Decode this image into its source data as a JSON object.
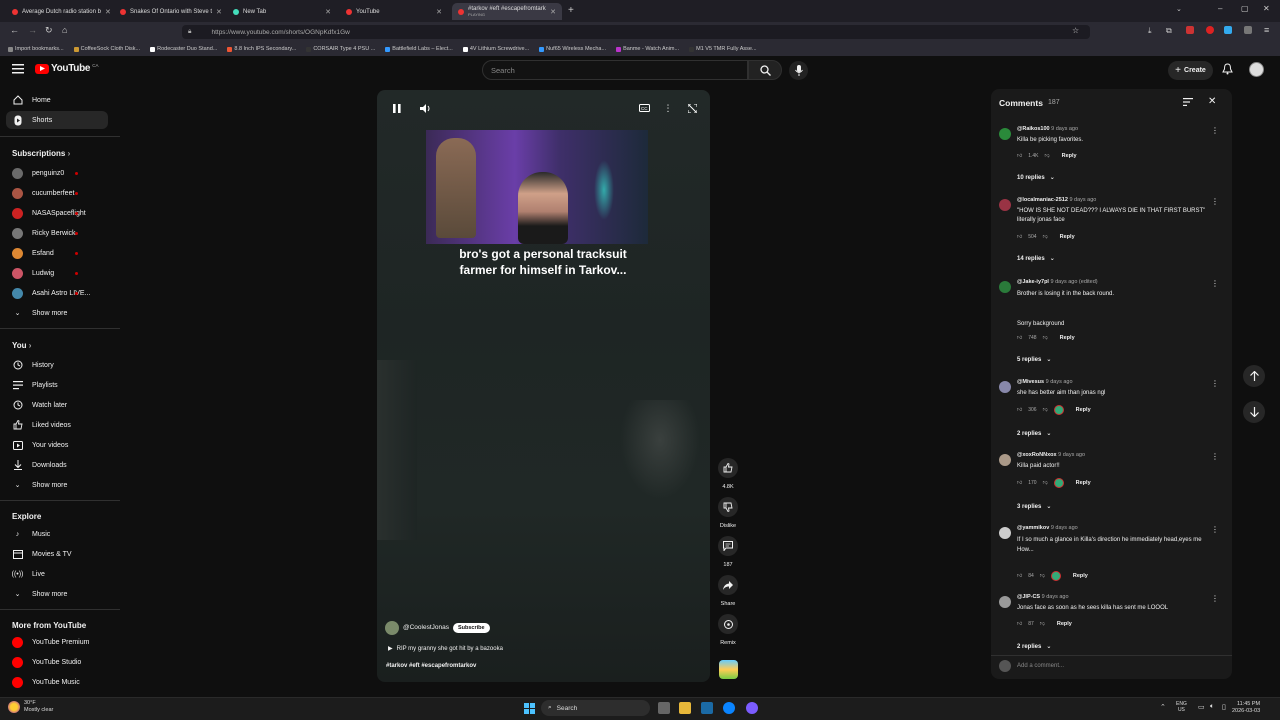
{
  "browser": {
    "tabs": [
      {
        "label": "Average Dutch radio station b"
      },
      {
        "label": "Snakes Of Ontario with Steve t"
      },
      {
        "label": "New Tab"
      },
      {
        "label": "YouTube"
      },
      {
        "label": "#tarkov #eft #escapefromtark",
        "sub": "PLAYING"
      }
    ],
    "url": "https://www.youtube.com/shorts/OGNpKdfx1Gw",
    "bookmarks": [
      "Import bookmarks...",
      "CoffeeSock Cloth Disk...",
      "Rodecaster Duo Stand...",
      "8.8 Inch IPS Secondary...",
      "CORSAIR Type 4 PSU ...",
      "Battlefield Labs – Elect...",
      "4V Lithium Screwdrive...",
      "Nuf65 Wireless Mecha...",
      "Banme - Watch Anim...",
      "M1 V5 TMR Fully Asse..."
    ]
  },
  "youtube": {
    "logo": "YouTube",
    "country": "CA",
    "search_placeholder": "Search",
    "create_label": "Create"
  },
  "sidebar": {
    "main": [
      {
        "label": "Home",
        "icon": "home-icon"
      },
      {
        "label": "Shorts",
        "icon": "shorts-icon"
      }
    ],
    "subscriptions_title": "Subscriptions",
    "subscriptions": [
      {
        "label": "penguinz0",
        "color": "#6a6a6a"
      },
      {
        "label": "cucumberfeet",
        "color": "#a54"
      },
      {
        "label": "NASASpaceflight",
        "color": "#c22"
      },
      {
        "label": "Ricky Berwick",
        "color": "#777"
      },
      {
        "label": "Esfand",
        "color": "#d83"
      },
      {
        "label": "Ludwig",
        "color": "#c56"
      },
      {
        "label": "Asahi Astro LIVE...",
        "color": "#48a"
      }
    ],
    "show_more": "Show more",
    "you_title": "You",
    "you": [
      {
        "label": "History",
        "icon": "history-icon"
      },
      {
        "label": "Playlists",
        "icon": "playlists-icon"
      },
      {
        "label": "Watch later",
        "icon": "clock-icon"
      },
      {
        "label": "Liked videos",
        "icon": "thumbs-up-icon"
      },
      {
        "label": "Your videos",
        "icon": "video-icon"
      },
      {
        "label": "Downloads",
        "icon": "download-icon"
      }
    ],
    "explore_title": "Explore",
    "explore": [
      {
        "label": "Music",
        "icon": "music-icon"
      },
      {
        "label": "Movies & TV",
        "icon": "film-icon"
      },
      {
        "label": "Live",
        "icon": "live-icon"
      }
    ],
    "more_title": "More from YouTube",
    "more": [
      {
        "label": "YouTube Premium"
      },
      {
        "label": "YouTube Studio"
      },
      {
        "label": "YouTube Music"
      }
    ]
  },
  "short": {
    "caption": "bro's got a personal tracksuit farmer for himself in Tarkov...",
    "channel": "@CoolestJonas",
    "subscribe": "Subscribe",
    "description": "RIP my granny she got hit by a bazooka",
    "tags": "#tarkov #eft #escapefromtarkov",
    "likes": "4.8K",
    "dislike": "Dislike",
    "comments": "187",
    "share": "Share",
    "remix": "Remix"
  },
  "comments": {
    "title": "Comments",
    "count": "187",
    "add_placeholder": "Add a comment...",
    "items": [
      {
        "user": "@Raikos100",
        "time": "9 days ago",
        "text": "Killa be picking favorites.",
        "likes": "1.4K",
        "hearted": false,
        "replies": "10 replies",
        "avatar": "#2a8a3a"
      },
      {
        "user": "@localmaniac-2512",
        "time": "9 days ago",
        "text": "\"HOW IS SHE NOT DEAD??? I ALWAYS DIE IN THAT FIRST BURST\" literally jonas face",
        "likes": "504",
        "hearted": false,
        "replies": "14 replies",
        "avatar": "#934"
      },
      {
        "user": "@Jake-iy7pl",
        "time": "9 days ago (edited)",
        "text": "Brother is losing it in the back round.\n\n\nSorry background",
        "likes": "748",
        "hearted": false,
        "replies": "5 replies",
        "avatar": "#2a7a3a"
      },
      {
        "user": "@Mivesus",
        "time": "9 days ago",
        "text": "she has better aim than jonas ngl",
        "likes": "306",
        "hearted": true,
        "replies": "2 replies",
        "avatar": "#88a"
      },
      {
        "user": "@xoxRoNNxox",
        "time": "9 days ago",
        "text": "Killa paid actor!!",
        "likes": "170",
        "hearted": true,
        "replies": "3 replies",
        "avatar": "#a98"
      },
      {
        "user": "@yammikov",
        "time": "9 days ago",
        "text": "If I so much a glance in Killa's direction he immediately head,eyes me\nHow...",
        "likes": "84",
        "hearted": true,
        "replies": "",
        "avatar": "#ccc"
      },
      {
        "user": "@JIP-CS",
        "time": "9 days ago",
        "text": "Jonas face as soon as he sees killa has sent me LOOOL",
        "likes": "87",
        "hearted": false,
        "replies": "2 replies",
        "avatar": "#999"
      }
    ],
    "reply_label": "Reply"
  },
  "taskbar": {
    "weather_temp": "30°F",
    "weather_text": "Mostly clear",
    "search": "Search",
    "lang": "ENG",
    "region": "US",
    "time": "11:45 PM",
    "date": "2026-03-03"
  }
}
